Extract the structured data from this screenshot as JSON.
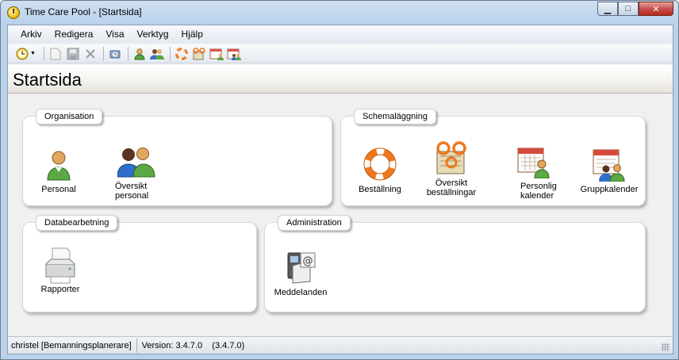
{
  "window": {
    "title": "Time Care Pool - [Startsida]",
    "controls": {
      "minimize": "▁",
      "maximize": "□",
      "close": "✕"
    }
  },
  "menu": [
    "Arkiv",
    "Redigera",
    "Visa",
    "Verktyg",
    "Hjälp"
  ],
  "toolbar": {
    "icons": [
      "clock-icon",
      "new-document-icon",
      "save-icon",
      "delete-icon",
      "refresh-icon",
      "person-icon",
      "persons-icon",
      "lifebuoy-icon",
      "booking-overview-icon",
      "personal-calendar-icon",
      "group-calendar-icon"
    ]
  },
  "header": {
    "title": "Startsida"
  },
  "panels": {
    "organisation": {
      "title": "Organisation",
      "items": [
        {
          "label": "Personal",
          "icon": "person-icon"
        },
        {
          "label": "Översikt\npersonal",
          "icon": "persons-overview-icon"
        }
      ]
    },
    "schemalaggning": {
      "title": "Schemaläggning",
      "items": [
        {
          "label": "Beställning",
          "icon": "lifebuoy-icon"
        },
        {
          "label": "Översikt\nbeställningar",
          "icon": "booking-overview-icon"
        },
        {
          "label": "Personlig\nkalender",
          "icon": "personal-calendar-icon"
        },
        {
          "label": "Gruppkalender",
          "icon": "group-calendar-icon"
        }
      ]
    },
    "databearbetning": {
      "title": "Databearbetning",
      "items": [
        {
          "label": "Rapporter",
          "icon": "printer-icon"
        }
      ]
    },
    "administration": {
      "title": "Administration",
      "items": [
        {
          "label": "Meddelanden",
          "icon": "messages-icon"
        }
      ]
    }
  },
  "status": {
    "user": "christel [Bemanningsplanerare]",
    "version": "Version: 3.4.7.0    (3.4.7.0)"
  },
  "colors": {
    "accent": "#3b73b9",
    "panel_bg": "#ffffff",
    "background": "#f0f0f0"
  }
}
